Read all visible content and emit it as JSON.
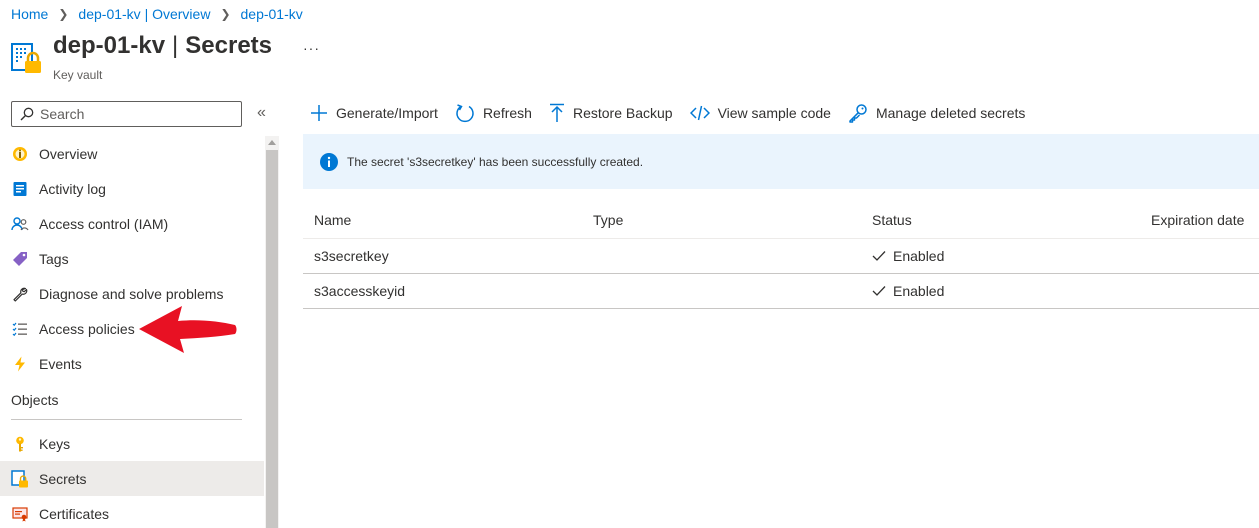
{
  "breadcrumb": {
    "items": [
      "Home",
      "dep-01-kv | Overview",
      "dep-01-kv"
    ],
    "separator": ">"
  },
  "header": {
    "resource_name": "dep-01-kv",
    "pipe": "|",
    "page_name": "Secrets",
    "subtitle": "Key vault",
    "more_label": "···",
    "icon": "key-vault-icon"
  },
  "sidebar": {
    "search_placeholder": "Search",
    "collapse_label": "«",
    "items": [
      {
        "label": "Overview",
        "icon": "overview-icon"
      },
      {
        "label": "Activity log",
        "icon": "activity-log-icon"
      },
      {
        "label": "Access control (IAM)",
        "icon": "iam-icon"
      },
      {
        "label": "Tags",
        "icon": "tag-icon"
      },
      {
        "label": "Diagnose and solve problems",
        "icon": "wrench-icon"
      },
      {
        "label": "Access policies",
        "icon": "policy-list-icon"
      },
      {
        "label": "Events",
        "icon": "lightning-icon"
      }
    ],
    "section_title": "Objects",
    "object_items": [
      {
        "label": "Keys",
        "icon": "key-icon"
      },
      {
        "label": "Secrets",
        "icon": "secret-icon",
        "selected": true
      },
      {
        "label": "Certificates",
        "icon": "certificate-icon"
      }
    ]
  },
  "toolbar": {
    "generate_import": "Generate/Import",
    "refresh": "Refresh",
    "restore_backup": "Restore Backup",
    "view_sample_code": "View sample code",
    "manage_deleted_secrets": "Manage deleted secrets"
  },
  "notification": {
    "message": "The secret 's3secretkey' has been successfully created."
  },
  "table": {
    "columns": [
      "Name",
      "Type",
      "Status",
      "Expiration date"
    ],
    "rows": [
      {
        "name": "s3secretkey",
        "type": "",
        "status": "Enabled",
        "expiration": ""
      },
      {
        "name": "s3accesskeyid",
        "type": "",
        "status": "Enabled",
        "expiration": ""
      }
    ]
  },
  "colors": {
    "accent": "#0078d4",
    "info_background": "#eaf4fd",
    "annotation_arrow": "#e81123",
    "selected_nav": "#edebe9"
  }
}
